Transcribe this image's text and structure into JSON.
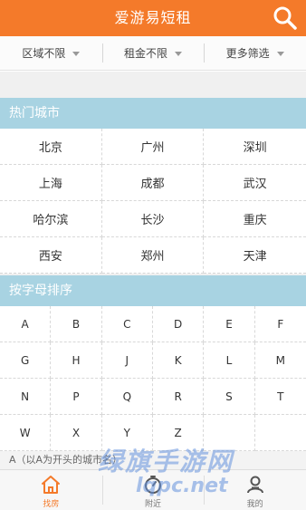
{
  "header": {
    "title": "爱游易短租",
    "search_icon": "search-icon"
  },
  "filters": [
    {
      "label": "区域不限"
    },
    {
      "label": "租金不限"
    },
    {
      "label": "更多筛选"
    }
  ],
  "hot_cities": {
    "title": "热门城市",
    "cities": [
      "北京",
      "广州",
      "深圳",
      "上海",
      "成都",
      "武汉",
      "哈尔滨",
      "长沙",
      "重庆",
      "西安",
      "郑州",
      "天津"
    ]
  },
  "alphabet": {
    "title": "按字母排序",
    "letters": [
      "A",
      "B",
      "C",
      "D",
      "E",
      "F",
      "G",
      "H",
      "J",
      "K",
      "L",
      "M",
      "N",
      "P",
      "Q",
      "R",
      "S",
      "T",
      "W",
      "X",
      "Y",
      "Z"
    ]
  },
  "hint": "A（以A为开头的城市名）",
  "tabbar": [
    {
      "label": "找房",
      "icon": "home-icon",
      "active": true
    },
    {
      "label": "附近",
      "icon": "compass-icon",
      "active": false
    },
    {
      "label": "我的",
      "icon": "user-icon",
      "active": false
    }
  ],
  "watermark": {
    "text": "绿旗手游网",
    "domain": "lqpc.net"
  },
  "colors": {
    "accent": "#f47a2a",
    "section": "#a8d3e2"
  }
}
